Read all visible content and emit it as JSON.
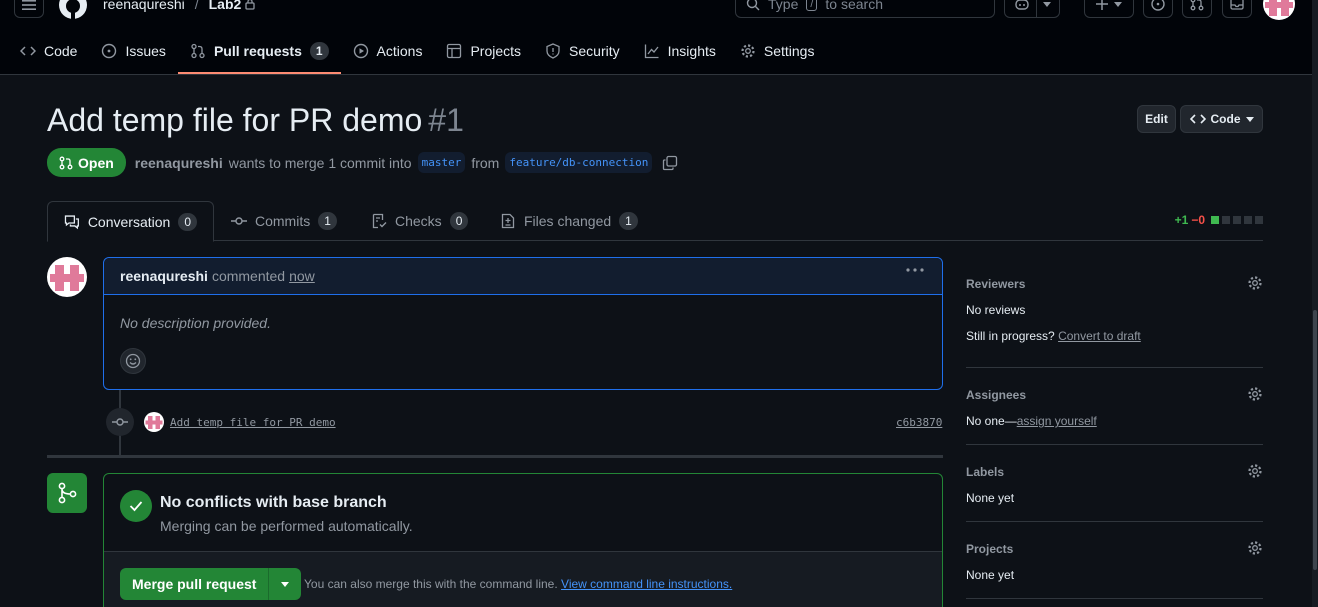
{
  "header": {
    "owner": "reenaqureshi",
    "separator": "/",
    "repo": "Lab2",
    "search_prefix": "Type",
    "search_key": "/",
    "search_suffix": "to search"
  },
  "nav": [
    {
      "label": "Code",
      "icon": "code-icon"
    },
    {
      "label": "Issues",
      "icon": "issue-icon"
    },
    {
      "label": "Pull requests",
      "icon": "pull-request-icon",
      "count": "1",
      "active": true
    },
    {
      "label": "Actions",
      "icon": "play-icon"
    },
    {
      "label": "Projects",
      "icon": "table-icon"
    },
    {
      "label": "Security",
      "icon": "shield-icon"
    },
    {
      "label": "Insights",
      "icon": "graph-icon"
    },
    {
      "label": "Settings",
      "icon": "gear-icon"
    }
  ],
  "pr": {
    "title": "Add temp file for PR demo",
    "number": "#1",
    "edit_label": "Edit",
    "code_label": "Code",
    "state": "Open",
    "author": "reenaqureshi",
    "merge_text": "wants to merge 1 commit into",
    "base_branch": "master",
    "from_text": "from",
    "head_branch": "feature/db-connection"
  },
  "tabs": {
    "conversation": {
      "label": "Conversation",
      "count": "0"
    },
    "commits": {
      "label": "Commits",
      "count": "1"
    },
    "checks": {
      "label": "Checks",
      "count": "0"
    },
    "files": {
      "label": "Files changed",
      "count": "1"
    },
    "additions": "+1",
    "deletions": "−0"
  },
  "comment": {
    "author": "reenaqureshi",
    "action": "commented",
    "time": "now",
    "body": "No description provided."
  },
  "commit": {
    "message": "Add temp file for PR demo",
    "sha": "c6b3870"
  },
  "merge": {
    "title": "No conflicts with base branch",
    "subtitle": "Merging can be performed automatically.",
    "button": "Merge pull request",
    "note": "You can also merge this with the command line.",
    "note_link": "View command line instructions."
  },
  "sidebar": {
    "reviewers": {
      "title": "Reviewers",
      "value": "No reviews",
      "extra": "Still in progress?",
      "extra_link": "Convert to draft"
    },
    "assignees": {
      "title": "Assignees",
      "value": "No one—",
      "value_link": "assign yourself"
    },
    "labels": {
      "title": "Labels",
      "value": "None yet"
    },
    "projects": {
      "title": "Projects",
      "value": "None yet"
    }
  },
  "colors": {
    "background": "#0d1117",
    "accent_green": "#238636",
    "accent_blue": "#1f6feb",
    "tab_underline": "#fd8c73"
  }
}
